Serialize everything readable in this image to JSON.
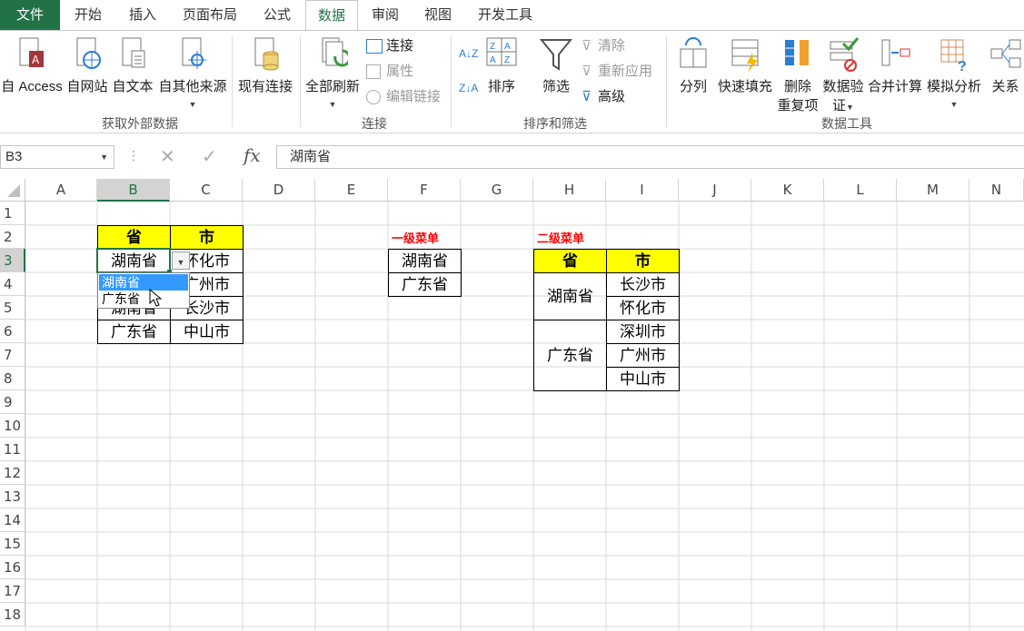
{
  "tabs": [
    {
      "label": "文件",
      "type": "file"
    },
    {
      "label": "开始"
    },
    {
      "label": "插入"
    },
    {
      "label": "页面布局"
    },
    {
      "label": "公式"
    },
    {
      "label": "数据",
      "type": "active"
    },
    {
      "label": "审阅"
    },
    {
      "label": "视图"
    },
    {
      "label": "开发工具"
    }
  ],
  "ribbon": {
    "get_external": {
      "access": "自 Access",
      "web": "自网站",
      "text": "自文本",
      "other": "自其他来源",
      "existing": "现有连接",
      "group": "获取外部数据"
    },
    "connections": {
      "refresh_all": "全部刷新",
      "connections": "连接",
      "properties": "属性",
      "edit_links": "编辑链接",
      "group": "连接"
    },
    "sort_filter": {
      "sort": "排序",
      "filter": "筛选",
      "clear": "清除",
      "reapply": "重新应用",
      "advanced": "高级",
      "group": "排序和筛选"
    },
    "data_tools": {
      "text_to_columns": "分列",
      "flash_fill": "快速填充",
      "remove_dup_1": "删除",
      "remove_dup_2": "重复项",
      "validation_1": "数据验",
      "validation_2": "证",
      "consolidate": "合并计算",
      "what_if": "模拟分析",
      "relationships": "关系",
      "group": "数据工具"
    }
  },
  "formula_bar": {
    "name_box": "B3",
    "cancel": "✕",
    "enter": "✓",
    "fx": "fx",
    "content": "湖南省"
  },
  "columns": [
    "A",
    "B",
    "C",
    "D",
    "E",
    "F",
    "G",
    "H",
    "I",
    "J",
    "K",
    "L",
    "M",
    "N"
  ],
  "rows": [
    "1",
    "2",
    "3",
    "4",
    "5",
    "6",
    "7",
    "8",
    "9",
    "10",
    "11",
    "12",
    "13",
    "14",
    "15",
    "16",
    "17",
    "18"
  ],
  "table1": {
    "header_province": "省",
    "header_city": "市",
    "rows": [
      {
        "province": "湖南省",
        "city": "怀化市"
      },
      {
        "province": "",
        "city": "广州市"
      },
      {
        "province": "湖南省",
        "city": "长沙市"
      },
      {
        "province": "广东省",
        "city": "中山市"
      }
    ]
  },
  "dropdown": {
    "options": [
      "湖南省",
      "广东省"
    ],
    "highlighted": "湖南省"
  },
  "level1": {
    "label": "一级菜单",
    "items": [
      "湖南省",
      "广东省"
    ]
  },
  "level2": {
    "label": "二级菜单",
    "header_province": "省",
    "header_city": "市",
    "group1": {
      "province": "湖南省",
      "cities": [
        "长沙市",
        "怀化市"
      ]
    },
    "group2": {
      "province": "广东省",
      "cities": [
        "深圳市",
        "广州市",
        "中山市"
      ]
    }
  },
  "colors": {
    "excel_green": "#217346",
    "header_yellow": "#ffff00",
    "label_red": "#ff0000",
    "dropdown_highlight": "#3399ff"
  }
}
